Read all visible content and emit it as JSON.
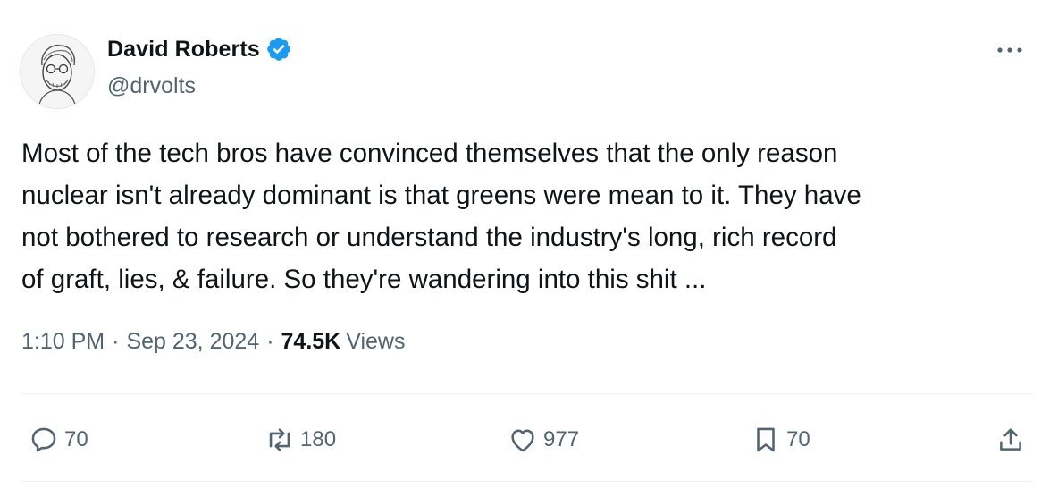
{
  "author": {
    "name": "David Roberts",
    "handle": "@drvolts",
    "verified": true,
    "avatar_icon": "portrait-sketch-avatar"
  },
  "tweet": {
    "text": "Most of the tech bros have convinced themselves that the only reason\nnuclear isn't already dominant is that greens were mean to it. They have\nnot bothered to research or understand the industry's long, rich record\nof graft, lies, & failure. So they're wandering into this shit ...",
    "time": "1:10 PM",
    "date": "Sep 23, 2024",
    "separator": "·",
    "views_count": "74.5K",
    "views_label": "Views"
  },
  "actions": {
    "replies": "70",
    "reposts": "180",
    "likes": "977",
    "bookmarks": "70"
  },
  "colors": {
    "text": "#0f1419",
    "secondary": "#536471",
    "verified": "#1d9bf0",
    "divider": "#eff3f4"
  }
}
